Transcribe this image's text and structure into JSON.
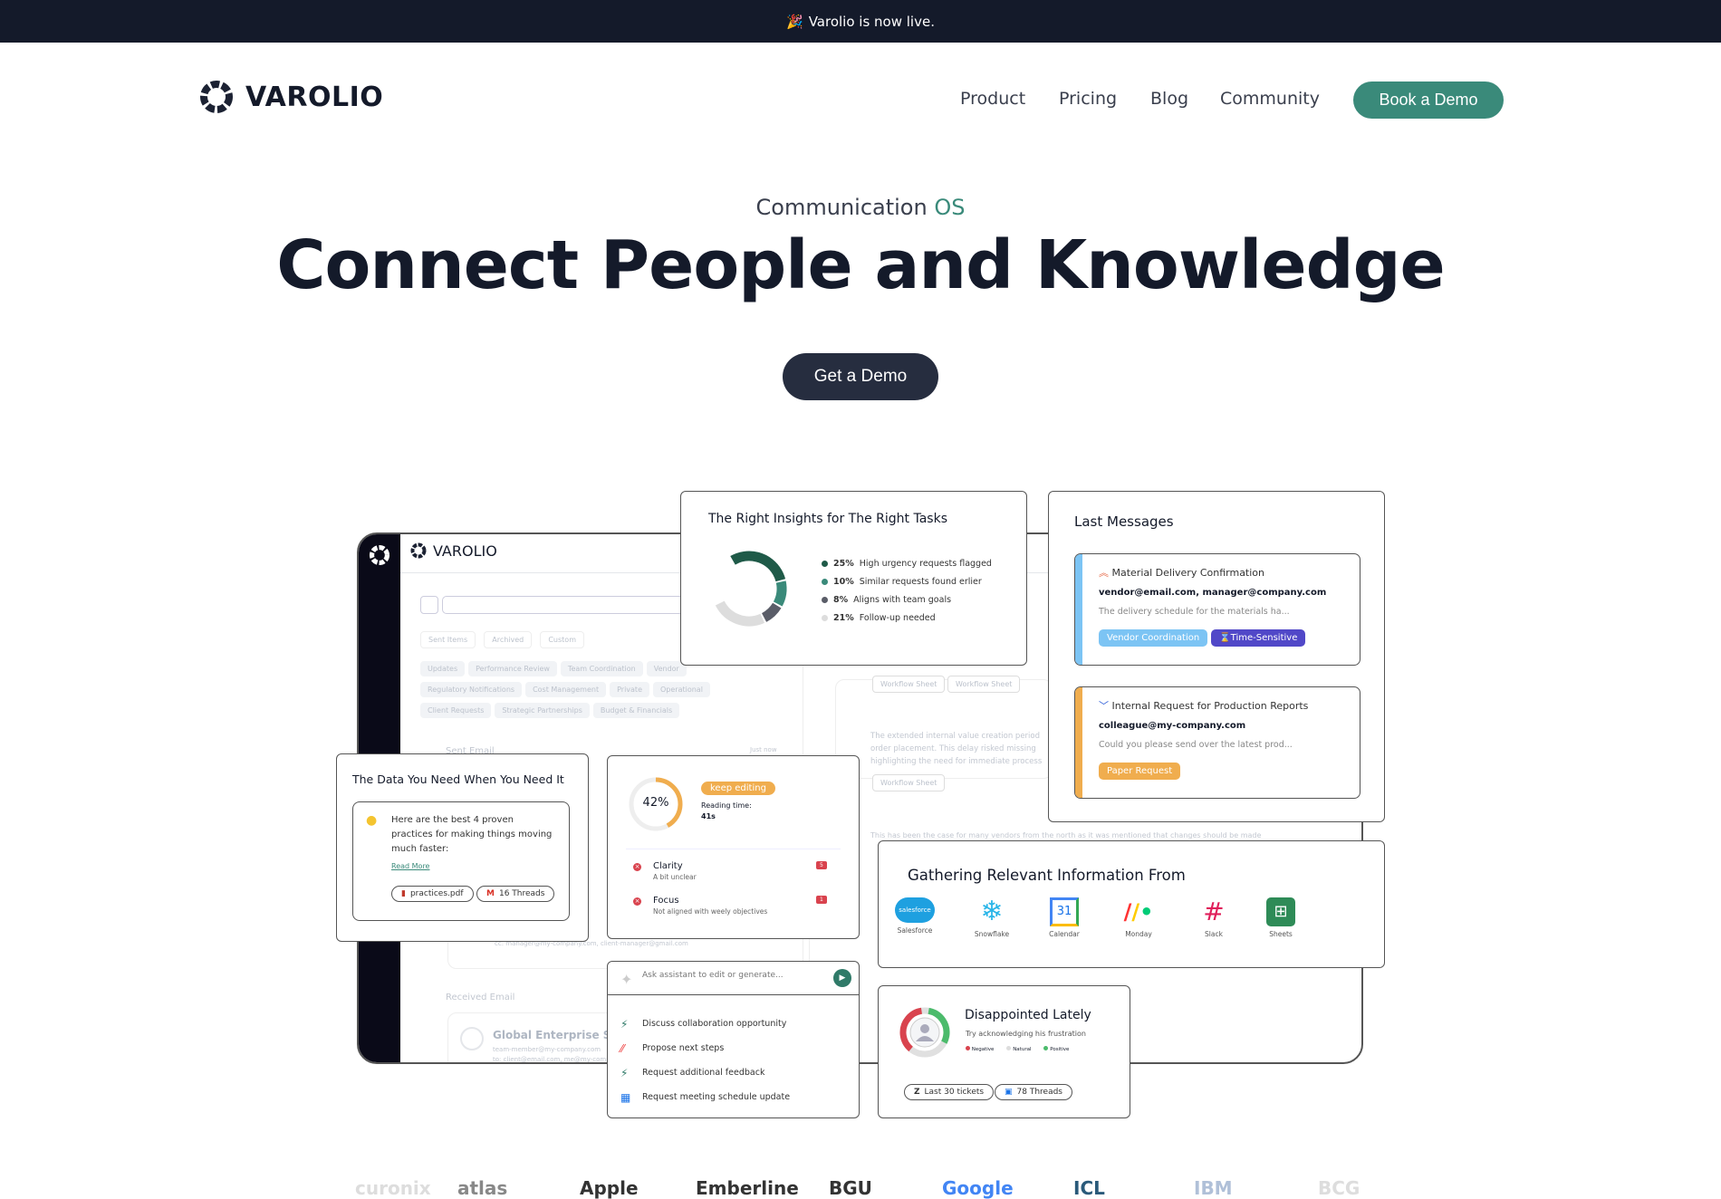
{
  "announcement": {
    "icon": "party-popper-icon",
    "text": "Varolio is now live."
  },
  "header": {
    "brand": "VAROLIO",
    "nav": [
      "Product",
      "Pricing",
      "Blog",
      "Community"
    ],
    "cta": "Book a Demo"
  },
  "hero": {
    "eyebrow_prefix": "Communication ",
    "eyebrow_accent": "OS",
    "title": "Connect People and Knowledge",
    "cta": "Get a Demo"
  },
  "colors": {
    "accent": "#3a8a7a",
    "dark": "#141a2a"
  },
  "dashboard": {
    "brand": "VAROLIO",
    "filters": [
      "Sent Items",
      "Archived",
      "Custom"
    ],
    "chips": [
      "Updates",
      "Performance Review",
      "Team Coordination",
      "Vendor",
      "Regulatory Notifications",
      "Cost Management",
      "Private",
      "Operational",
      "Client Requests",
      "Strategic Partnerships",
      "Budget & Financials"
    ],
    "sent_email": "Sent Email",
    "just_now": "Just now",
    "received_email": "Received Email",
    "global": "Global Enterprise Sear",
    "global_from": "team-member@my-company.com",
    "global_to": "to: client@email.com, me@my-comp",
    "cc": "cc: manager@my-company.com, client-manager@gmail.com",
    "workflow_sheet": "Workflow Sheet",
    "insight_text": "The extended internal value creation period order placement. This delay risked missing highlighting the need for immediate process",
    "vendors_text": "This has been the case for many vendors from the north as it was mentioned that changes should be made"
  },
  "insights": {
    "title": "The Right Insights for The Right Tasks",
    "items": [
      {
        "pct": "25%",
        "label": "High urgency requests flagged",
        "value": 25,
        "color": "#1f5a48"
      },
      {
        "pct": "10%",
        "label": "Similar requests found erlier",
        "value": 10,
        "color": "#3a8a7a"
      },
      {
        "pct": "8%",
        "label": "Aligns with team goals",
        "value": 8,
        "color": "#5a5d68"
      },
      {
        "pct": "21%",
        "label": "Follow-up needed",
        "value": 21,
        "color": "#dddddd"
      }
    ]
  },
  "messages": {
    "title": "Last Messages",
    "items": [
      {
        "priority_icon": "double-chevron-up-icon",
        "subject": "Material Delivery Confirmation",
        "to": "vendor@email.com, manager@company.com",
        "preview": "The delivery schedule for the materials ha...",
        "tags": [
          "Vendor Coordination",
          "Time-Sensitive"
        ],
        "bar": "#7cc4f4"
      },
      {
        "priority_icon": "chevron-down-icon",
        "subject": "Internal Request for Production Reports",
        "to": "colleague@my-company.com",
        "preview": "Could you please send over the latest prod...",
        "tags": [
          "Paper Request"
        ],
        "bar": "#f0ad4e"
      }
    ]
  },
  "data_card": {
    "title": "The Data You Need When You Need It",
    "text": "Here are the best 4 proven practices for making things moving much faster:",
    "link": "Read More",
    "attachments": [
      "practices.pdf",
      "16 Threads"
    ]
  },
  "editing": {
    "score": "42%",
    "score_value": 42,
    "badge": "keep editing",
    "reading_label": "Reading time:",
    "reading_value": "41s",
    "issues": [
      {
        "name": "Clarity",
        "desc": "A bit unclear",
        "count": "5"
      },
      {
        "name": "Focus",
        "desc": "Not aligned with weely objectives",
        "count": "1"
      }
    ]
  },
  "assistant": {
    "placeholder": "Ask assistant to edit or generate...",
    "suggestions": [
      "Discuss collaboration opportunity",
      "Propose next steps",
      "Request additional feedback",
      "Request meeting schedule update"
    ]
  },
  "sources": {
    "title": "Gathering Relevant Information From",
    "items": [
      "Salesforce",
      "Snowflake",
      "Calendar",
      "Monday",
      "Slack",
      "Sheets"
    ],
    "calendar_day": "31",
    "salesforce_logo": "salesforce"
  },
  "sentiment": {
    "title": "Disappointed Lately",
    "subtitle": "Try acknowledging his frustration",
    "legend": [
      "Negative",
      "Natural",
      "Positive"
    ],
    "pills": [
      "Last 30 tickets",
      "78 Threads"
    ]
  },
  "customer_logos": [
    "curonix",
    "atlas",
    "Apple",
    "Emberline",
    "BGU",
    "Google",
    "ICL",
    "IBM",
    "BCG"
  ]
}
